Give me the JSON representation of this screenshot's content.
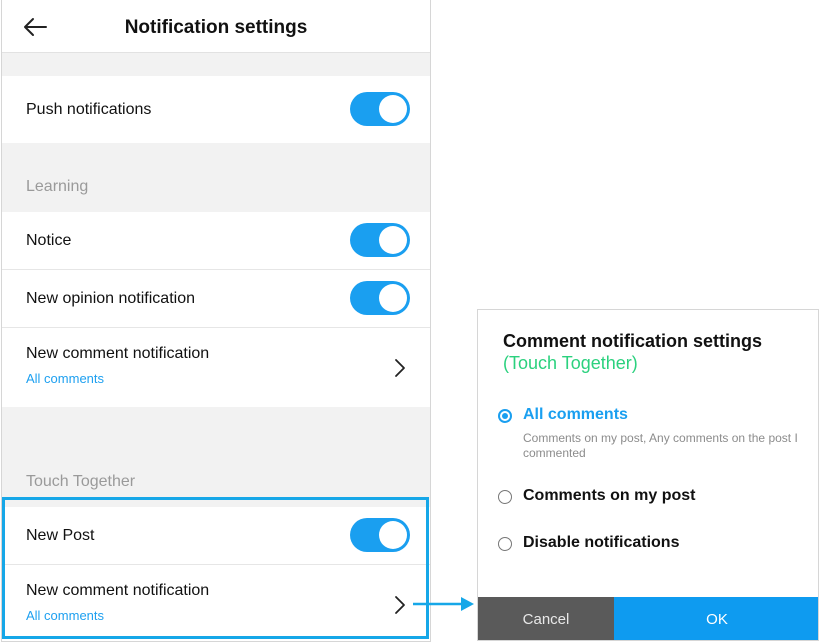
{
  "header": {
    "title": "Notification settings"
  },
  "push": {
    "label": "Push notifications",
    "enabled": true
  },
  "learning": {
    "section_label": "Learning",
    "notice": {
      "label": "Notice",
      "enabled": true
    },
    "opinion": {
      "label": "New opinion notification",
      "enabled": true
    },
    "comment": {
      "label": "New comment notification",
      "value": "All comments"
    }
  },
  "touch_together": {
    "section_label": "Touch Together",
    "new_post": {
      "label": "New Post",
      "enabled": true
    },
    "comment": {
      "label": "New comment notification",
      "value": "All comments"
    }
  },
  "dialog": {
    "title": "Comment notification settings",
    "subtitle": "(Touch Together)",
    "options": [
      {
        "label": "All comments",
        "selected": true
      },
      {
        "label": "Comments on my post",
        "selected": false
      },
      {
        "label": "Disable notifications",
        "selected": false
      }
    ],
    "selected_description": "Comments on my post, Any comments on the post I commented",
    "cancel_label": "Cancel",
    "ok_label": "OK"
  },
  "colors": {
    "accent": "#1a9ff0",
    "highlight_border": "#16a7e8",
    "subtitle_green": "#2bd17e",
    "cancel_bg": "#5a5a5a"
  }
}
